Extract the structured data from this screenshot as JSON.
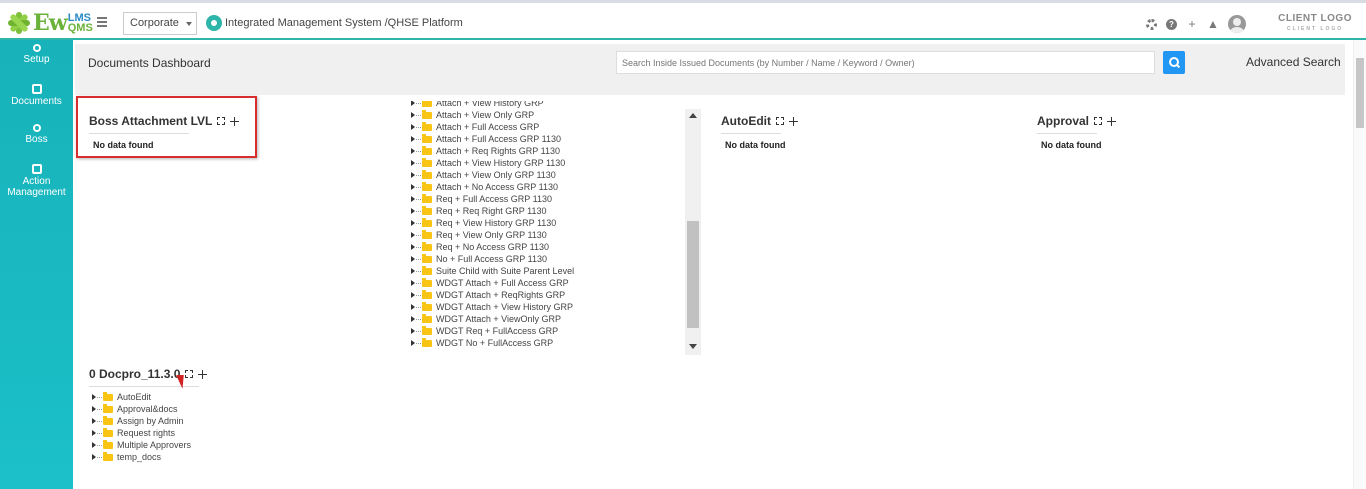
{
  "header": {
    "logo_main": "Ew",
    "logo_top": "LMS",
    "logo_bottom": "QMS",
    "org_select": "Corporate",
    "system_title": "Integrated Management System /QHSE Platform",
    "client_logo": "CLIENT LOGO",
    "client_logo_sub": "CLIENT LOGO"
  },
  "sidebar": {
    "items": [
      {
        "label": "Setup"
      },
      {
        "label": "Documents"
      },
      {
        "label": "Boss"
      },
      {
        "label": "Action Management"
      }
    ]
  },
  "dashboard": {
    "title": "Documents Dashboard",
    "search_placeholder": "Search Inside Issued Documents (by Number / Name / Keyword / Owner)",
    "advanced_search": "Advanced Search"
  },
  "widgets": {
    "boss_attachment": {
      "title": "Boss Attachment LVL",
      "empty": "No data found"
    },
    "autoedit": {
      "title": "AutoEdit",
      "empty": "No data found"
    },
    "approval": {
      "title": "Approval",
      "empty": "No data found"
    },
    "docpro": {
      "title": "0 Docpro_11.3.0",
      "items": [
        "AutoEdit",
        "Approval&docs",
        "Assign by Admin",
        "Request rights",
        "Multiple Approvers",
        "temp_docs"
      ]
    },
    "tree_list": {
      "items": [
        "Attach + View History GRP",
        "Attach + View Only GRP",
        "Attach + Full Access GRP",
        "Attach + Full Access GRP 1130",
        "Attach + Req Rights GRP 1130",
        "Attach + View History GRP 1130",
        "Attach + View Only GRP 1130",
        "Attach + No Access GRP 1130",
        "Req + Full Access GRP 1130",
        "Req + Req Right GRP 1130",
        "Req + View History GRP 1130",
        "Req + View Only GRP 1130",
        "Req + No Access GRP 1130",
        "No + Full Access GRP 1130",
        "Suite Child with Suite Parent Level",
        "WDGT Attach + Full Access GRP",
        "WDGT Attach + ReqRights GRP",
        "WDGT Attach + View History GRP",
        "WDGT Attach + ViewOnly GRP",
        "WDGT Req + FullAccess GRP",
        "WDGT No + FullAccess GRP"
      ]
    }
  },
  "colors": {
    "accent": "#2cb5a8",
    "sidebar": "#18b2ba",
    "search_button": "#2196f3",
    "highlight": "#d62d2d",
    "folder": "#f9c514"
  }
}
